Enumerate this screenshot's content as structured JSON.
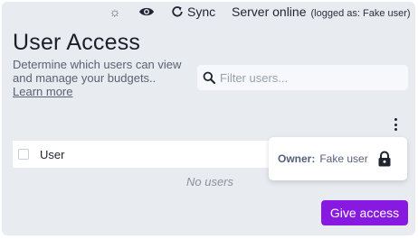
{
  "topbar": {
    "theme_icon": "sun-icon",
    "privacy_icon": "eye-icon",
    "sync_icon": "sync-icon",
    "sync_label": "Sync",
    "server_status": "Server online",
    "logged_as": "(logged as: Fake user)"
  },
  "page": {
    "title": "User Access",
    "description": "Determine which users can view and manage your budgets..",
    "learn_more": "Learn more"
  },
  "filter": {
    "placeholder": "Filter users...",
    "value": ""
  },
  "table": {
    "column_user": "User",
    "empty_text": "No users"
  },
  "owner": {
    "label": "Owner:",
    "name": "Fake user"
  },
  "actions": {
    "give_access": "Give access"
  },
  "colors": {
    "accent": "#8719e0",
    "background": "#e8ebf0"
  }
}
